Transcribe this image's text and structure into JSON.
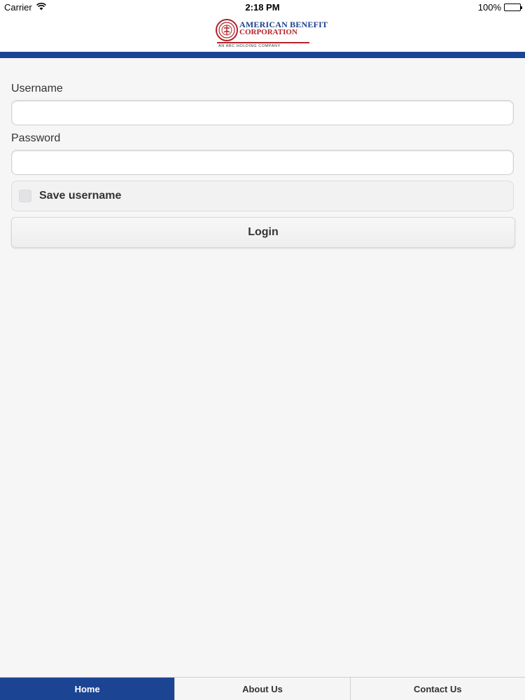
{
  "status_bar": {
    "carrier": "Carrier",
    "time": "2:18 PM",
    "battery": "100%",
    "wifi_icon": "wifi-icon",
    "battery_icon": "battery-icon"
  },
  "logo": {
    "line1": "AMERICAN BENEFIT",
    "line2": "CORPORATION",
    "sub": "AN ABC HOLDING COMPANY",
    "colors": {
      "blue": "#1d3f8c",
      "red": "#b22327"
    }
  },
  "form": {
    "username_label": "Username",
    "username_value": "",
    "password_label": "Password",
    "password_value": "",
    "save_username_label": "Save username",
    "save_username_checked": false,
    "login_label": "Login"
  },
  "tabbar": {
    "tabs": [
      {
        "label": "Home",
        "active": true
      },
      {
        "label": "About Us",
        "active": false
      },
      {
        "label": "Contact Us",
        "active": false
      }
    ]
  },
  "colors": {
    "brand_blue": "#1b4593",
    "background": "#f6f6f7"
  }
}
